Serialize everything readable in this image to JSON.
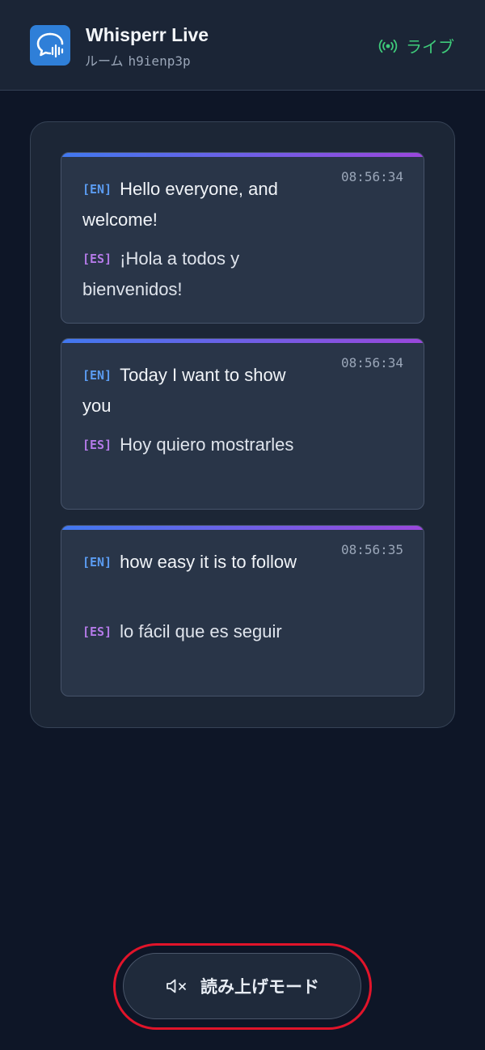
{
  "header": {
    "title": "Whisperr Live",
    "room_label": "ルーム",
    "room_id": "h9ienp3p",
    "live_label": "ライブ",
    "logo_icon": "chat-waveform-icon",
    "live_icon": "broadcast-icon"
  },
  "messages": [
    {
      "time": "08:56:34",
      "en_tag": "[EN]",
      "en": "Hello everyone, and welcome!",
      "es_tag": "[ES]",
      "es": "¡Hola a todos y bienvenidos!"
    },
    {
      "time": "08:56:34",
      "en_tag": "[EN]",
      "en": "Today I want to show you",
      "es_tag": "[ES]",
      "es": "Hoy quiero mostrarles"
    },
    {
      "time": "08:56:35",
      "en_tag": "[EN]",
      "en": "how easy it is to follow",
      "es_tag": "[ES]",
      "es": "lo fácil que es seguir"
    }
  ],
  "readout": {
    "label": "読み上げモード",
    "icon": "speaker-muted-icon"
  },
  "colors": {
    "background": "#0e1627",
    "accent_blue": "#4178ef",
    "accent_purple": "#9a47dc",
    "live_green": "#3ecb7a",
    "highlight_red": "#e1142a"
  }
}
